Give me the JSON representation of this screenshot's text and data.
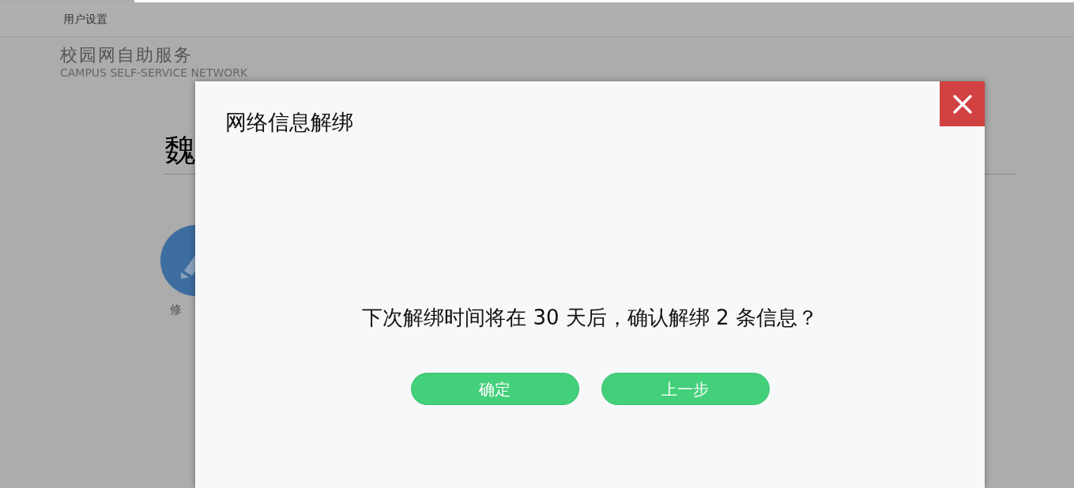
{
  "topbar": {
    "menu_item": "用户设置"
  },
  "brand": {
    "title": "校园网自助服务",
    "subtitle": "CAMPUS  SELF-SERVICE NETWORK"
  },
  "page": {
    "heading": "魏",
    "action_label": "修"
  },
  "dialog": {
    "title": "网络信息解绑",
    "message": "下次解绑时间将在 30 天后，确认解绑 2 条信息？",
    "buttons": [
      "确定",
      "上一步"
    ]
  }
}
